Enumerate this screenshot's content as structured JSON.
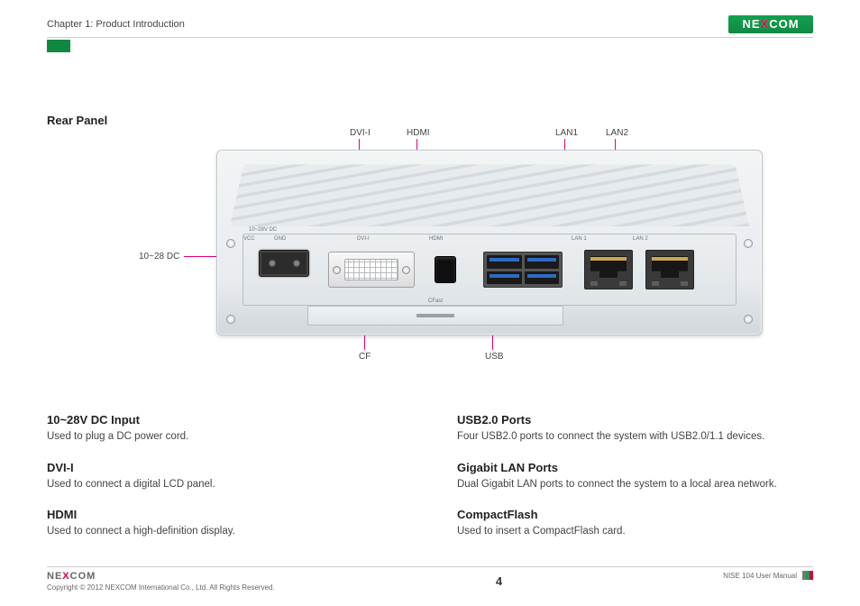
{
  "header": {
    "chapter": "Chapter 1: Product Introduction",
    "brand_left": "NE",
    "brand_x": "X",
    "brand_right": "COM"
  },
  "section": {
    "title": "Rear Panel"
  },
  "callouts": {
    "dc": "10~28 DC",
    "dvi": "DVI-I",
    "hdmi": "HDMI",
    "lan1": "LAN1",
    "lan2": "LAN2",
    "cf": "CF",
    "usb": "USB"
  },
  "device_labels": {
    "dc_top": "10~28V  DC",
    "vcc": "VCC",
    "gnd": "GND",
    "dvi_face": "DVI-I",
    "hdmi_face": "HDMI",
    "lan1_face": "LAN 1",
    "lan2_face": "LAN 2",
    "cfast": "CFast"
  },
  "descriptions": {
    "left": [
      {
        "title": "10~28V DC Input",
        "text": "Used to plug a DC power cord."
      },
      {
        "title": "DVI-I",
        "text": "Used to connect a digital LCD panel."
      },
      {
        "title": "HDMI",
        "text": "Used to connect a high-definition display."
      }
    ],
    "right": [
      {
        "title": "USB2.0 Ports",
        "text": "Four USB2.0 ports to connect the system with USB2.0/1.1 devices."
      },
      {
        "title": "Gigabit LAN Ports",
        "text": "Dual Gigabit LAN ports to connect the system to a local area network."
      },
      {
        "title": "CompactFlash",
        "text": "Used to insert a CompactFlash card."
      }
    ]
  },
  "footer": {
    "copyright": "Copyright © 2012 NEXCOM International Co., Ltd. All Rights Reserved.",
    "page": "4",
    "doc": "NISE 104 User Manual"
  }
}
